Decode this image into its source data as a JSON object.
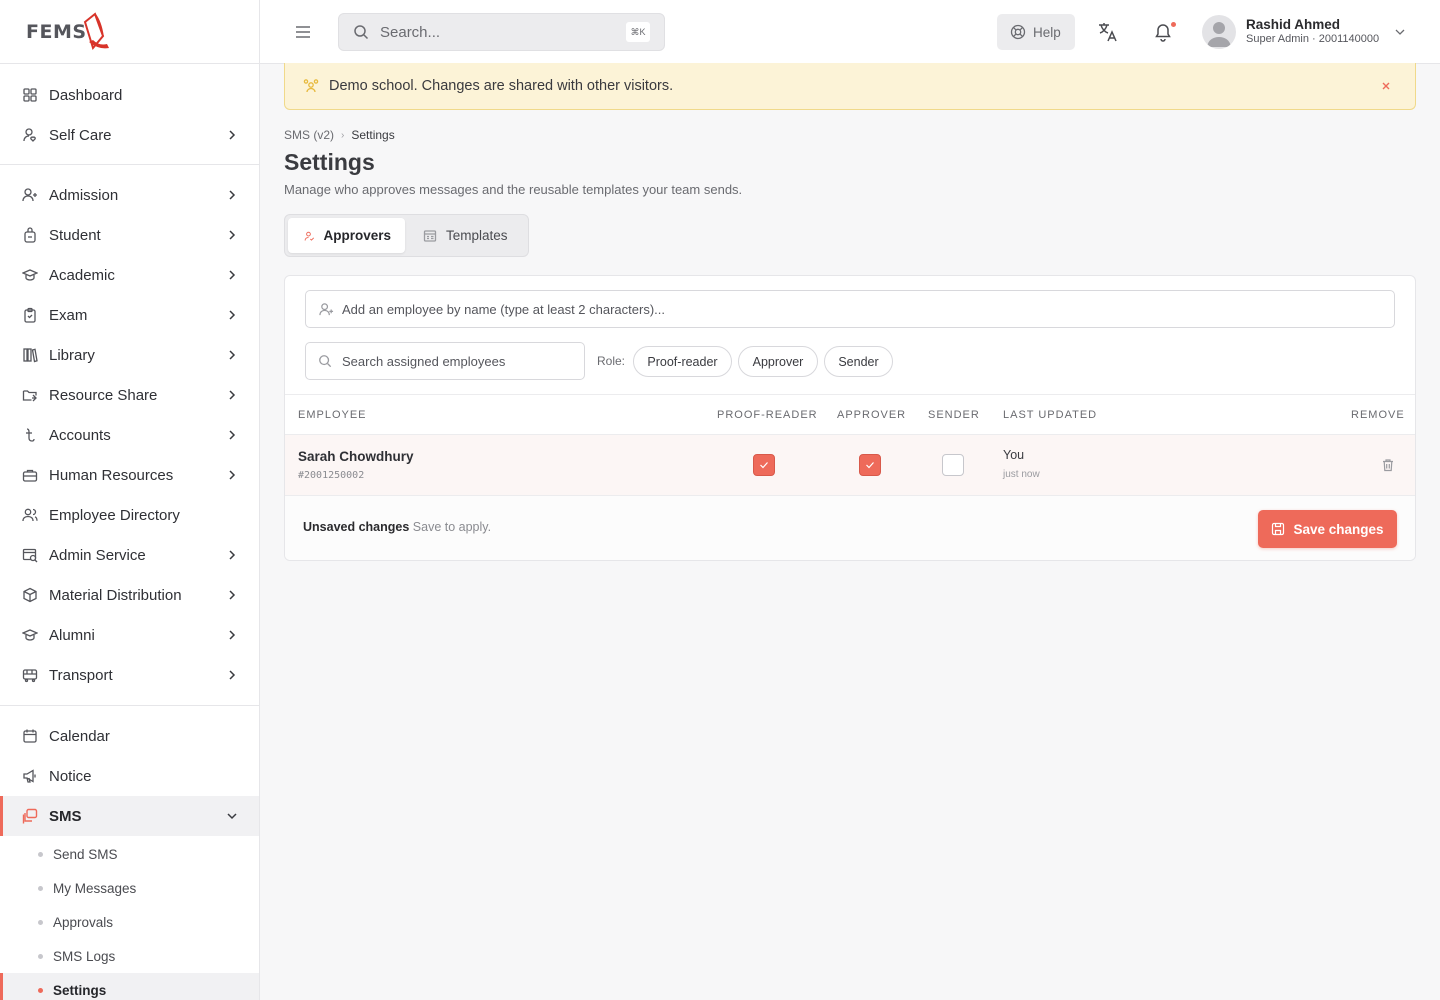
{
  "brand": {
    "logo_text": "FEMS",
    "accent": "#ee6a5a"
  },
  "sidebar": {
    "top": [
      {
        "label": "Dashboard",
        "icon": "grid-icon"
      },
      {
        "label": "Self Care",
        "icon": "user-heart-icon"
      }
    ],
    "modules": [
      {
        "label": "Admission",
        "icon": "user-plus-icon"
      },
      {
        "label": "Student",
        "icon": "backpack-icon"
      },
      {
        "label": "Academic",
        "icon": "graduation-cap-icon"
      },
      {
        "label": "Exam",
        "icon": "clipboard-icon"
      },
      {
        "label": "Library",
        "icon": "books-icon"
      },
      {
        "label": "Resource Share",
        "icon": "folder-share-icon"
      },
      {
        "label": "Accounts",
        "icon": "currency-icon"
      },
      {
        "label": "Human Resources",
        "icon": "briefcase-icon"
      },
      {
        "label": "Employee Directory",
        "icon": "users-icon"
      },
      {
        "label": "Admin Service",
        "icon": "admin-service-icon"
      },
      {
        "label": "Material Distribution",
        "icon": "package-icon"
      },
      {
        "label": "Alumni",
        "icon": "graduation-cap-icon"
      },
      {
        "label": "Transport",
        "icon": "bus-icon"
      }
    ],
    "bottom": [
      {
        "label": "Calendar",
        "icon": "calendar-icon"
      },
      {
        "label": "Notice",
        "icon": "megaphone-icon"
      }
    ],
    "sms": {
      "label": "SMS",
      "icon": "message-icon",
      "sub_items": [
        "Send SMS",
        "My Messages",
        "Approvals",
        "SMS Logs",
        "Settings"
      ]
    }
  },
  "header": {
    "search_placeholder": "Search...",
    "search_shortcut": "⌘K",
    "help_label": "Help",
    "user_name": "Rashid Ahmed",
    "user_role": "Super Admin · 2001140000"
  },
  "banner": {
    "text": "Demo school. Changes are shared with other visitors."
  },
  "page": {
    "breadcrumb": [
      "SMS (v2)",
      "Settings"
    ],
    "title": "Settings",
    "subtitle": "Manage who approves messages and the reusable templates your team sends.",
    "tabs": [
      "Approvers",
      "Templates"
    ]
  },
  "approvers": {
    "add_placeholder": "Add an employee by name (type at least 2 characters)...",
    "filter_placeholder": "Search assigned employees",
    "role_label": "Role:",
    "role_chips": [
      "Proof-reader",
      "Approver",
      "Sender"
    ],
    "columns": [
      "Employee",
      "Proof-reader",
      "Approver",
      "Sender",
      "Last updated",
      "Remove"
    ],
    "rows": [
      {
        "name": "Sarah Chowdhury",
        "id": "#2001250002",
        "proof_reader": true,
        "approver": true,
        "sender": false,
        "updated_by": "You",
        "updated_when": "just now"
      }
    ],
    "unsaved_title": "Unsaved changes",
    "unsaved_hint": "Save to apply.",
    "save_label": "Save changes"
  }
}
